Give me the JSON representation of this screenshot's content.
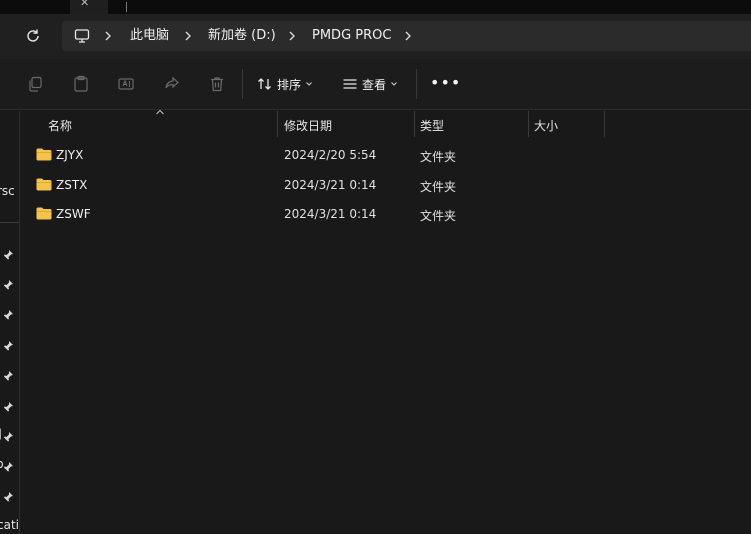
{
  "titlebar": {
    "close_glyph": "✕"
  },
  "breadcrumb": {
    "items": [
      {
        "label": "此电脑"
      },
      {
        "label": "新加卷 (D:)"
      },
      {
        "label": "PMDG PROC"
      }
    ]
  },
  "toolbar": {
    "sort_label": "排序",
    "view_label": "查看",
    "more_glyph": "•••"
  },
  "nav": {
    "partial_top": "rsc",
    "partial_bottom": "cati",
    "partial_left_glyphs": [
      "]",
      "b"
    ]
  },
  "columns": {
    "name": "名称",
    "modified": "修改日期",
    "type": "类型",
    "size": "大小"
  },
  "files": [
    {
      "name": "ZJYX",
      "modified": "2024/2/20 5:54",
      "type": "文件夹",
      "size": ""
    },
    {
      "name": "ZSTX",
      "modified": "2024/3/21 0:14",
      "type": "文件夹",
      "size": ""
    },
    {
      "name": "ZSWF",
      "modified": "2024/3/21 0:14",
      "type": "文件夹",
      "size": ""
    }
  ],
  "colors": {
    "folder": "#f4c34a",
    "background": "#191919",
    "address_bar": "#2b2b2b"
  }
}
